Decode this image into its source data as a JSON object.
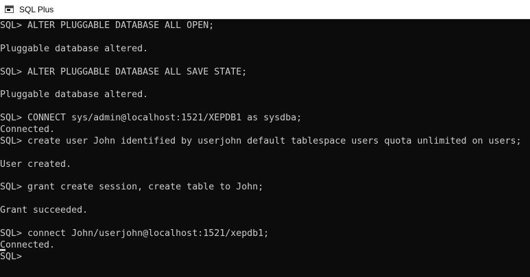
{
  "window": {
    "title": "SQL Plus"
  },
  "console": {
    "lines": [
      "SQL> ALTER PLUGGABLE DATABASE ALL OPEN;",
      "",
      "Pluggable database altered.",
      "",
      "SQL> ALTER PLUGGABLE DATABASE ALL SAVE STATE;",
      "",
      "Pluggable database altered.",
      "",
      "SQL> CONNECT sys/admin@localhost:1521/XEPDB1 as sysdba;",
      "Connected.",
      "SQL> create user John identified by userjohn default tablespace users quota unlimited on users;",
      "",
      "User created.",
      "",
      "SQL> grant create session, create table to John;",
      "",
      "Grant succeeded.",
      "",
      "SQL> connect John/userjohn@localhost:1521/xepdb1;",
      "Connected.",
      "SQL>"
    ]
  },
  "colors": {
    "background": "#0c0c0c",
    "text": "#cccccc",
    "titlebar": "#ffffff"
  },
  "icons": {
    "app": "console-window-icon"
  }
}
